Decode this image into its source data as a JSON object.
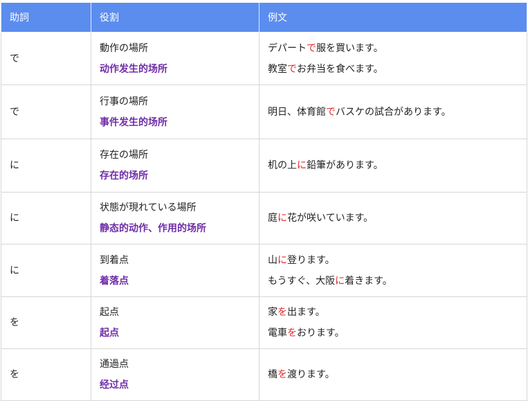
{
  "headers": [
    "助詞",
    "役割",
    "例文"
  ],
  "rows": [
    {
      "particle": "で",
      "role_jp": "動作の場所",
      "role_zh": "动作发生的场所",
      "examples": [
        {
          "pre": "デパート",
          "mark": "で",
          "post": "服を買います。"
        },
        {
          "pre": "教室",
          "mark": "で",
          "post": "お弁当を食べます。"
        }
      ]
    },
    {
      "particle": "で",
      "role_jp": "行事の場所",
      "role_zh": "事件发生的场所",
      "examples": [
        {
          "pre": "明日、体育館",
          "mark": "で",
          "post": "バスケの試合があります。"
        }
      ]
    },
    {
      "particle": "に",
      "role_jp": "存在の場所",
      "role_zh": "存在的场所",
      "examples": [
        {
          "pre": "机の上",
          "mark": "に",
          "post": "鉛筆があります。"
        }
      ]
    },
    {
      "particle": "に",
      "role_jp": "状態が現れている場所",
      "role_zh": "静态的动作、作用的场所",
      "examples": [
        {
          "pre": "庭",
          "mark": "に",
          "post": "花が咲いています。"
        }
      ]
    },
    {
      "particle": "に",
      "role_jp": "到着点",
      "role_zh": "着落点",
      "examples": [
        {
          "pre": "山",
          "mark": "に",
          "post": "登ります。"
        },
        {
          "pre": "もうすぐ、大阪",
          "mark": "に",
          "post": "着きます。"
        }
      ]
    },
    {
      "particle": "を",
      "role_jp": "起点",
      "role_zh": "起点",
      "examples": [
        {
          "pre": "家",
          "mark": "を",
          "post": "出ます。"
        },
        {
          "pre": "電車",
          "mark": "を",
          "post": "おります。"
        }
      ]
    },
    {
      "particle": "を",
      "role_jp": "通過点",
      "role_zh": "经过点",
      "examples": [
        {
          "pre": "橋",
          "mark": "を",
          "post": "渡ります。"
        }
      ]
    }
  ],
  "colors": {
    "header_bg": "#5b8def",
    "particle_mark": "#e02828",
    "role_zh": "#6f2da8"
  }
}
